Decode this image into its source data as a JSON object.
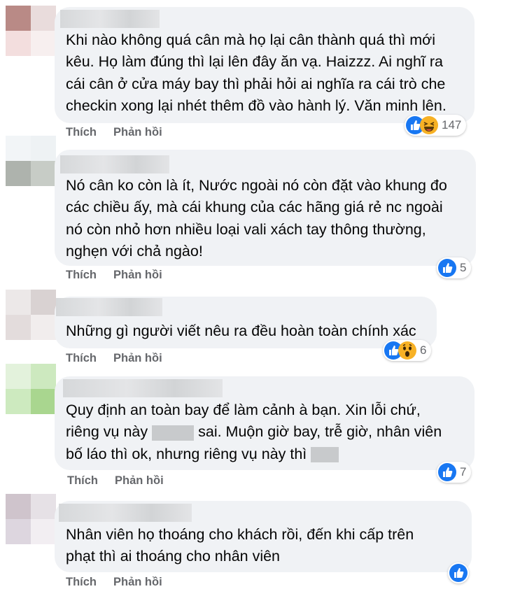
{
  "comments": [
    {
      "lines": [
        "Khi nào không quá cân mà họ lại cân thành quá thì mới",
        "kêu. Họ làm đúng thì lại lên đây ăn vạ. Haizzz. Ai nghĩ ra",
        "cái cân ở cửa máy bay thì phải hỏi ai nghĩa ra cái trò che",
        "checkin xong lại nhét thêm đồ vào hành lý. Văn minh lên."
      ],
      "like_label": "Thích",
      "reply_label": "Phản hồi",
      "reaction_count": "147",
      "reactions": [
        "like-icon",
        "haha-icon"
      ]
    },
    {
      "lines": [
        "Nó cân ko còn là ít, Nước ngoài nó còn đặt vào khung đo",
        "các chiều ấy, mà cái khung của các hãng giá rẻ nc ngoài",
        "nó còn nhỏ hơn nhiều loại vali xách tay thông thường,",
        "nghẹn với chả ngào!"
      ],
      "like_label": "Thích",
      "reply_label": "Phản hồi",
      "reaction_count": "5",
      "reactions": [
        "like-icon"
      ]
    },
    {
      "lines": [
        "Những gì người viết nêu ra đều hoàn toàn chính xác"
      ],
      "like_label": "Thích",
      "reply_label": "Phản hồi",
      "reaction_count": "6",
      "reactions": [
        "like-icon",
        "wow-icon"
      ]
    },
    {
      "line1": "Quy định an toàn bay để làm cảnh à bạn. Xin lỗi chứ,",
      "line2_a": "riêng vụ này",
      "line2_b": "sai. Muộn giờ bay, trễ giờ, nhân viên",
      "line3": "bố láo thì ok, nhưng riêng vụ này thì",
      "like_label": "Thích",
      "reply_label": "Phản hồi",
      "reaction_count": "7",
      "reactions": [
        "like-icon"
      ]
    },
    {
      "lines": [
        "Nhân viên họ thoáng cho khách rồi, đến khi cấp trên",
        "phạt thì ai thoáng cho nhân viên"
      ],
      "like_label": "Thích",
      "reply_label": "Phản hồi",
      "reaction_count": "",
      "reactions": [
        "like-icon"
      ]
    }
  ],
  "colors": {
    "bubble": "#f0f2f5",
    "action_text": "#65676b",
    "like_blue": "#1877f2",
    "haha_yellow": "#f7b125"
  }
}
